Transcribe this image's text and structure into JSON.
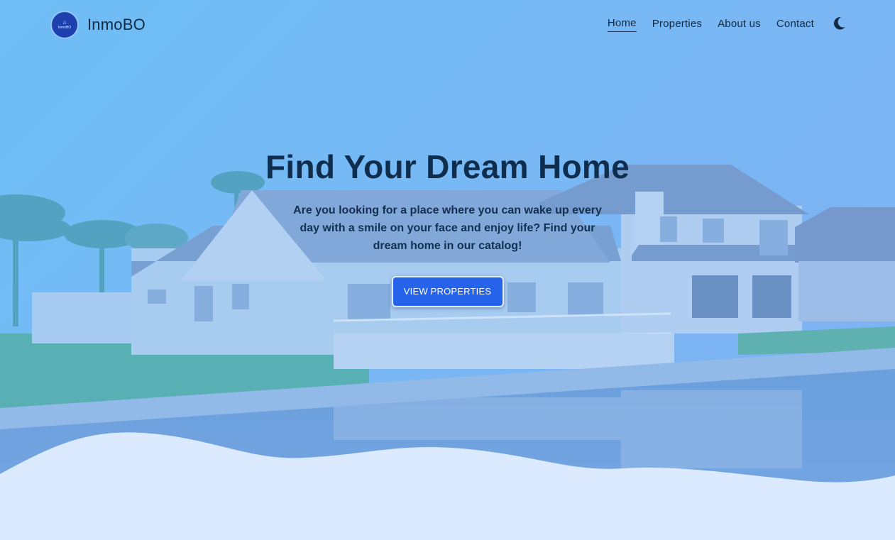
{
  "brand": {
    "name": "InmoBO",
    "logo_text": "InmoBO",
    "logo_icon": "house-icon"
  },
  "nav": {
    "items": [
      {
        "label": "Home",
        "active": true
      },
      {
        "label": "Properties",
        "active": false
      },
      {
        "label": "About us",
        "active": false
      },
      {
        "label": "Contact",
        "active": false
      }
    ],
    "theme_toggle_icon": "moon-icon"
  },
  "hero": {
    "title": "Find Your Dream Home",
    "subtitle": "Are you looking for a place where you can wake up every day with a smile on your face and enjoy life? Find your dream home in our catalog!",
    "cta_label": "VIEW PROPERTIES",
    "background_icon": "house-photo"
  },
  "colors": {
    "accent": "#2563eb",
    "text_dark": "#0f2e4d",
    "overlay": "#60a5fa",
    "wave": "#dbeafe",
    "logo_bg": "#1e40af"
  }
}
